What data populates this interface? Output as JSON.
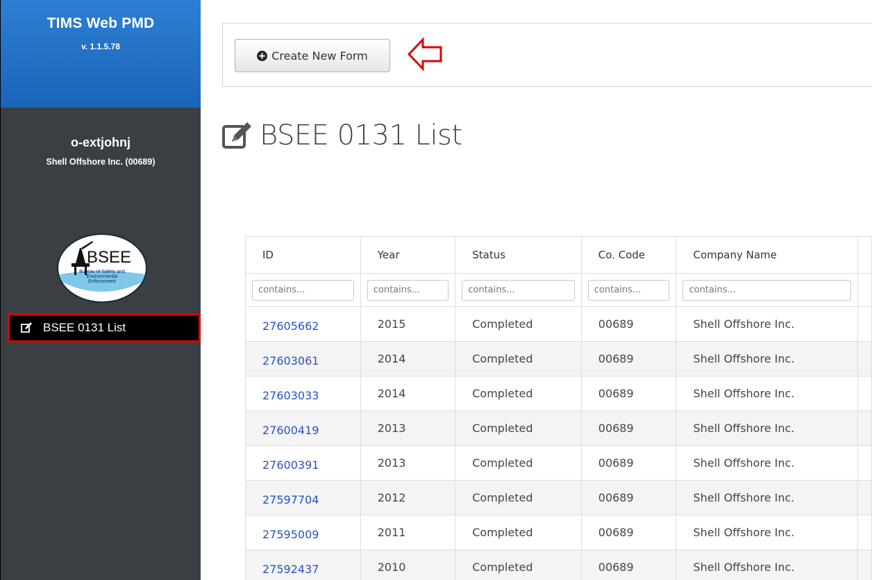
{
  "sidebar": {
    "app_title": "TIMS Web PMD",
    "app_version": "v. 1.1.5.78",
    "username": "o-extjohnj",
    "company": "Shell Offshore Inc. (00689)",
    "logo": {
      "text": "BSEE",
      "subtitle_line1": "Bureau of Safety and",
      "subtitle_line2": "Environmental",
      "subtitle_line3": "Enforcement"
    },
    "nav": [
      {
        "label": "BSEE 0131 List",
        "icon": "edit-icon",
        "active": true
      }
    ]
  },
  "toolbar": {
    "create_label": "Create New Form",
    "create_icon": "plus-circle-icon"
  },
  "page": {
    "title": "BSEE 0131 List",
    "title_icon": "edit-icon"
  },
  "table": {
    "columns": [
      "ID",
      "Year",
      "Status",
      "Co. Code",
      "Company Name"
    ],
    "filter_placeholders": [
      "contains...",
      "contains...",
      "contains...",
      "contains...",
      "contains..."
    ],
    "rows": [
      {
        "id": "27605662",
        "year": "2015",
        "status": "Completed",
        "code": "00689",
        "name": "Shell Offshore Inc."
      },
      {
        "id": "27603061",
        "year": "2014",
        "status": "Completed",
        "code": "00689",
        "name": "Shell Offshore Inc."
      },
      {
        "id": "27603033",
        "year": "2014",
        "status": "Completed",
        "code": "00689",
        "name": "Shell Offshore Inc."
      },
      {
        "id": "27600419",
        "year": "2013",
        "status": "Completed",
        "code": "00689",
        "name": "Shell Offshore Inc."
      },
      {
        "id": "27600391",
        "year": "2013",
        "status": "Completed",
        "code": "00689",
        "name": "Shell Offshore Inc."
      },
      {
        "id": "27597704",
        "year": "2012",
        "status": "Completed",
        "code": "00689",
        "name": "Shell Offshore Inc."
      },
      {
        "id": "27595009",
        "year": "2011",
        "status": "Completed",
        "code": "00689",
        "name": "Shell Offshore Inc."
      },
      {
        "id": "27592437",
        "year": "2010",
        "status": "Completed",
        "code": "00689",
        "name": "Shell Offshore Inc."
      }
    ]
  },
  "colors": {
    "sidebar_bg": "#3a3f44",
    "brand_blue": "#1a64b8",
    "highlight_red": "#e00000",
    "link_blue": "#2a4fc8"
  }
}
